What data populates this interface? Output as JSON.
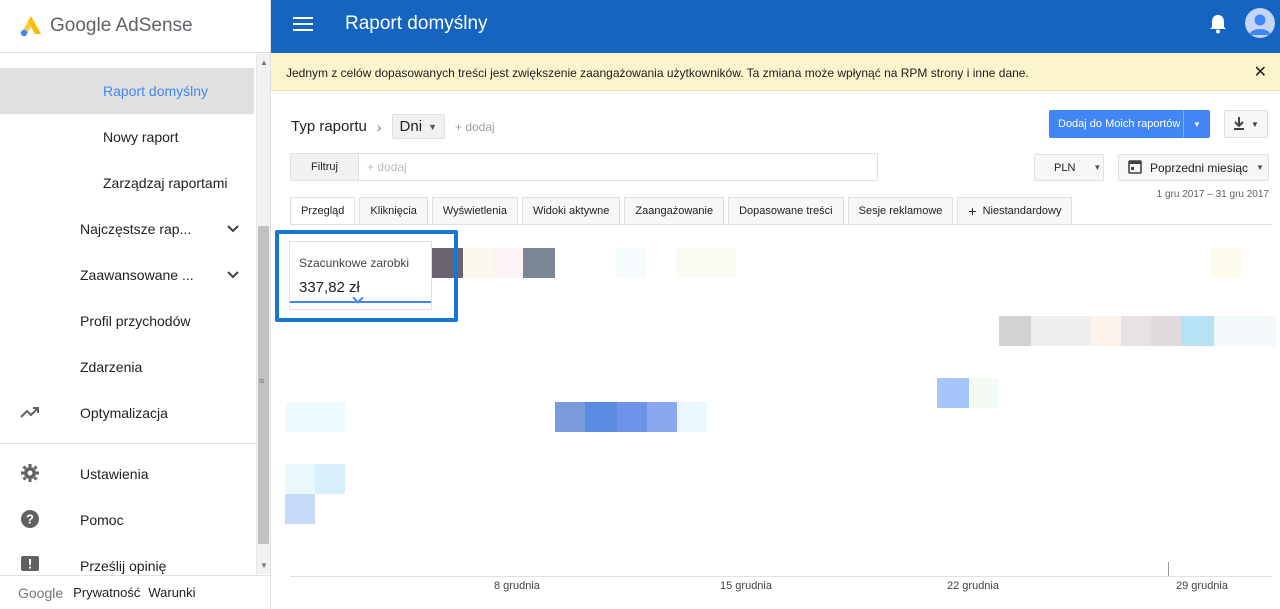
{
  "app": {
    "name": "Google AdSense"
  },
  "topbar": {
    "title": "Raport domyślny"
  },
  "sidebar": {
    "items": [
      {
        "label": "Raport domyślny"
      },
      {
        "label": "Nowy raport"
      },
      {
        "label": "Zarządzaj raportami"
      },
      {
        "label": "Najczęstsze rap..."
      },
      {
        "label": "Zaawansowane ..."
      },
      {
        "label": "Profil przychodów"
      },
      {
        "label": "Zdarzenia"
      },
      {
        "label": "Optymalizacja"
      },
      {
        "label": "Ustawienia"
      },
      {
        "label": "Pomoc"
      },
      {
        "label": "Prześlij opinię"
      }
    ],
    "footer": {
      "google": "Google",
      "privacy": "Prywatność",
      "terms": "Warunki"
    }
  },
  "notice": {
    "text": "Jednym z celów dopasowanych treści jest zwiększenie zaangażowania użytkowników. Ta zmiana może wpłynąć na RPM strony i inne dane."
  },
  "report": {
    "type_label": "Typ raportu",
    "dimension": "Dni",
    "add_label": "+ dodaj",
    "save_button": "Dodaj do Moich raportów",
    "filter_label": "Filtruj",
    "filter_placeholder": "+ dodaj",
    "currency": "PLN",
    "period": "Poprzedni miesiąc",
    "date_range": "1 gru 2017 – 31 gru 2017",
    "tabs": [
      "Przegląd",
      "Kliknięcia",
      "Wyświetlenia",
      "Widoki aktywne",
      "Zaangażowanie",
      "Dopasowane treści",
      "Sesje reklamowe",
      "Niestandardowy"
    ],
    "metric": {
      "label": "Szacunkowe zarobki",
      "value": "337,82 zł"
    },
    "x_labels": [
      "8 grudnia",
      "15 grudnia",
      "22 grudnia",
      "29 grudnia"
    ]
  },
  "colors": {
    "topbar": "#1565c0",
    "accent": "#4285f4",
    "notice_bg": "#fdf3cd",
    "highlight": "#1976d2"
  }
}
